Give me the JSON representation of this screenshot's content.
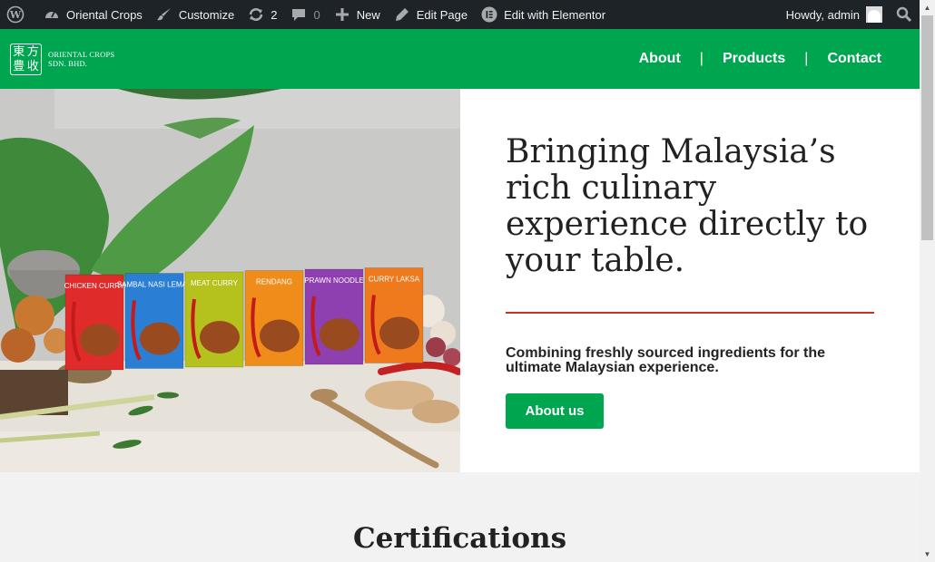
{
  "adminbar": {
    "site_name": "Oriental Crops",
    "customize": "Customize",
    "updates_count": "2",
    "comments_count": "0",
    "new_label": "New",
    "edit_page": "Edit Page",
    "elementor_label": "Edit with Elementor",
    "howdy": "Howdy, admin"
  },
  "header": {
    "logo_glyphs": [
      "東",
      "方",
      "豊",
      "收"
    ],
    "logo_line1": "ORIENTAL CROPS",
    "logo_line2": "SDN. BHD.",
    "nav": [
      {
        "label": "About"
      },
      {
        "label": "Products"
      },
      {
        "label": "Contact"
      }
    ],
    "nav_separator": "|"
  },
  "hero": {
    "heading": "Bringing Malaysia’s rich culinary experience directly to your table.",
    "subheading": "Combining freshly sourced ingredients for the ultimate Malaysian experience.",
    "button_label": "About us",
    "products": [
      {
        "name": "CHICKEN CURRY",
        "color": "#e02b2b"
      },
      {
        "name": "SAMBAL NASI LEMAK",
        "color": "#2a7fd4"
      },
      {
        "name": "MEAT CURRY",
        "color": "#b5c21e"
      },
      {
        "name": "RENDANG",
        "color": "#f08c1a"
      },
      {
        "name": "PRAWN NOODLE",
        "color": "#8e3fb0"
      },
      {
        "name": "CURRY LAKSA",
        "color": "#ef7a1e"
      }
    ]
  },
  "certifications": {
    "title": "Certifications"
  },
  "colors": {
    "brand_green": "#00a550",
    "accent_red": "#c9302c",
    "admin_bar": "#1d2327"
  }
}
